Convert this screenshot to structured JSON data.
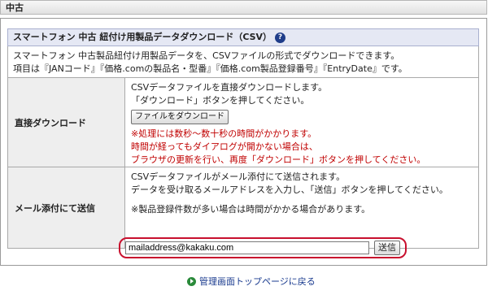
{
  "section": {
    "title": "中古"
  },
  "panel": {
    "title": "スマートフォン 中古 紐付け用製品データダウンロード（CSV）",
    "help_icon": "question-circle-icon",
    "description": [
      "スマートフォン 中古製品紐付け用製品データを、CSVファイルの形式でダウンロードできます。",
      "項目は『JANコード』『価格.comの製品名・型番』『価格.com製品登録番号』『EntryDate』です。"
    ]
  },
  "direct": {
    "label": "直接ダウンロード",
    "lines": [
      "CSVデータファイルを直接ダウンロードします。",
      "「ダウンロード」ボタンを押してください。"
    ],
    "button_label": "ファイルをダウンロード",
    "notes": [
      "※処理には数秒～数十秒の時間がかかります。",
      "時間が経ってもダイアログが開かない場合は、",
      "ブラウザの更新を行い、再度「ダウンロード」ボタンを押してください。"
    ]
  },
  "mail": {
    "label": "メール添付にて送信",
    "lines": [
      "CSVデータファイルがメール添付にて送信されます。",
      "データを受け取るメールアドレスを入力し、「送信」ボタンを押してください。"
    ],
    "note": "※製品登録件数が多い場合は時間がかかる場合があります。",
    "email_value": "mailaddress@kakaku.com",
    "send_label": "送信"
  },
  "footer": {
    "link_label": "管理画面トップページに戻る",
    "icon": "arrow-circle-icon"
  },
  "colors": {
    "accent_red": "#c8102e",
    "title_bar": "#e5e8f4",
    "link": "#1a3b8f"
  }
}
